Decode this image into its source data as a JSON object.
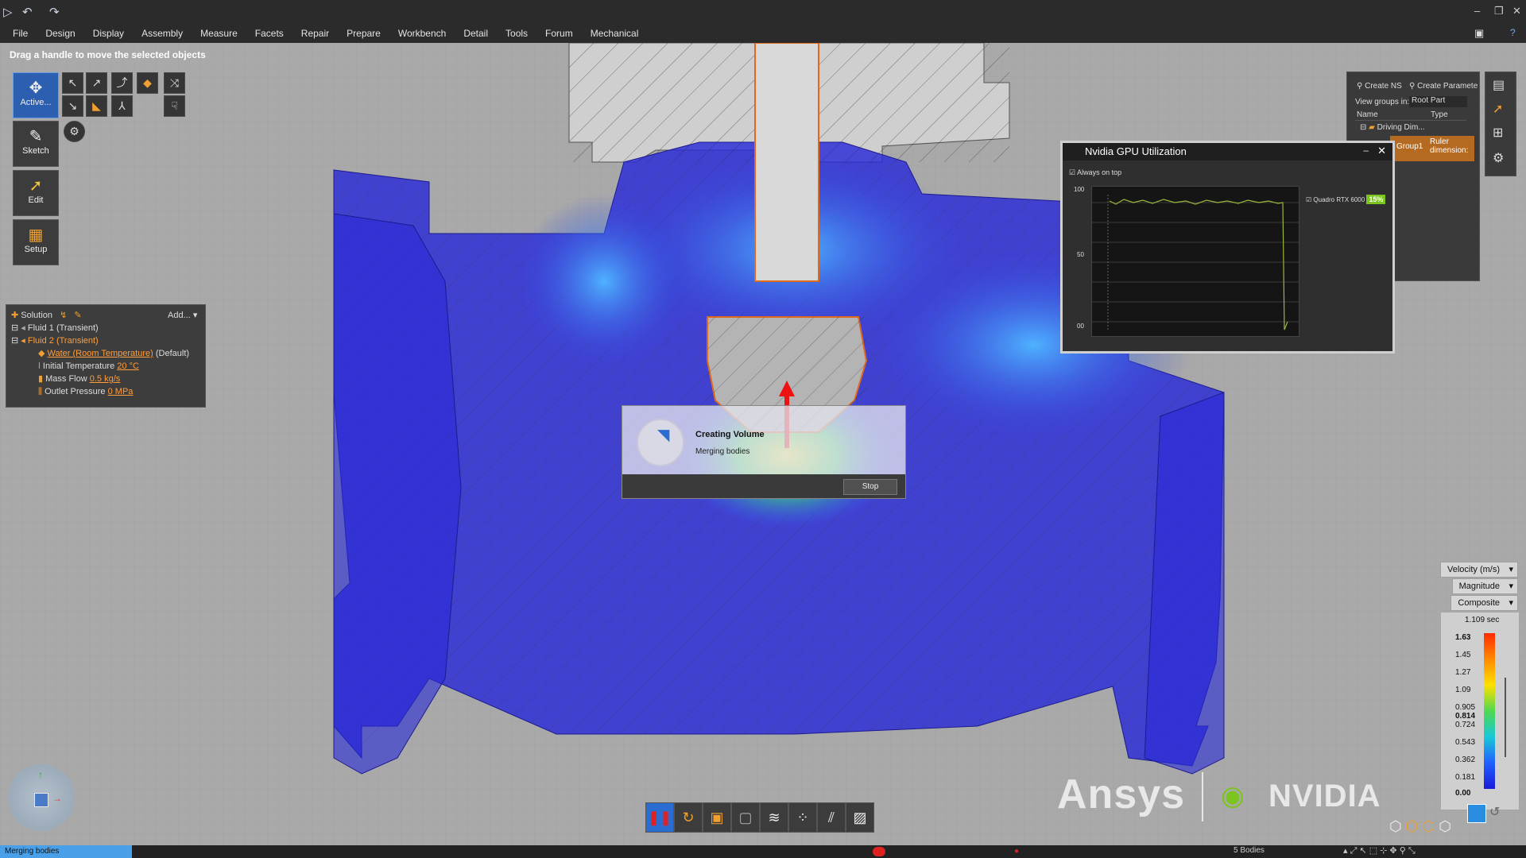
{
  "menu": [
    "File",
    "Design",
    "Display",
    "Assembly",
    "Measure",
    "Facets",
    "Repair",
    "Prepare",
    "Workbench",
    "Detail",
    "Tools",
    "Forum",
    "Mechanical"
  ],
  "hint": "Drag a handle to move the selected objects",
  "tools": {
    "active": "Active...",
    "sketch": "Sketch",
    "edit": "Edit",
    "setup": "Setup"
  },
  "solution": {
    "header": "Solution",
    "add": "Add...",
    "fluid1": "Fluid 1 (Transient)",
    "fluid2": "Fluid 2 (Transient)",
    "water": "Water (Room Temperature)",
    "water_default": "(Default)",
    "init_temp_label": "Initial Temperature",
    "init_temp_value": "20 °C",
    "mass_flow_label": "Mass Flow",
    "mass_flow_value": "0.5 kg/s",
    "outlet_label": "Outlet Pressure",
    "outlet_value": "0 MPa"
  },
  "groups": {
    "create_ns": "Create NS",
    "create_param": "Create Paramete",
    "view_label": "View groups in:",
    "view_value": "Root Part",
    "col_name": "Name",
    "col_type": "Type",
    "item1": "Driving Dim...",
    "item2": "Group1",
    "item2_type": "Ruler dimension:"
  },
  "gpu": {
    "title": "Nvidia GPU Utilization",
    "always_on_top": "Always on top",
    "y100": "100",
    "y50": "50",
    "y0": "00",
    "device": "Quadro RTX 6000",
    "percent": "15%"
  },
  "dialog": {
    "title": "Creating Volume",
    "subtitle": "Merging bodies",
    "stop": "Stop"
  },
  "legend": {
    "quantity": "Velocity (m/s)",
    "component": "Magnitude",
    "mode": "Composite",
    "time": "1.109 sec",
    "values": [
      "1.63",
      "1.45",
      "1.27",
      "1.09",
      "0.905",
      "0.814",
      "0.724",
      "0.543",
      "0.362",
      "0.181",
      "0.00"
    ]
  },
  "brands": {
    "ansys": "Ansys",
    "nvidia": "NVIDIA"
  },
  "status": {
    "left": "Merging bodies",
    "bodies": "5 Bodies"
  },
  "colors": {
    "flow_blue": "#2a2ad8",
    "accent_orange": "#ff9d3a",
    "select_blue": "#2b6cd3",
    "gpu_green": "#7cc41e"
  }
}
